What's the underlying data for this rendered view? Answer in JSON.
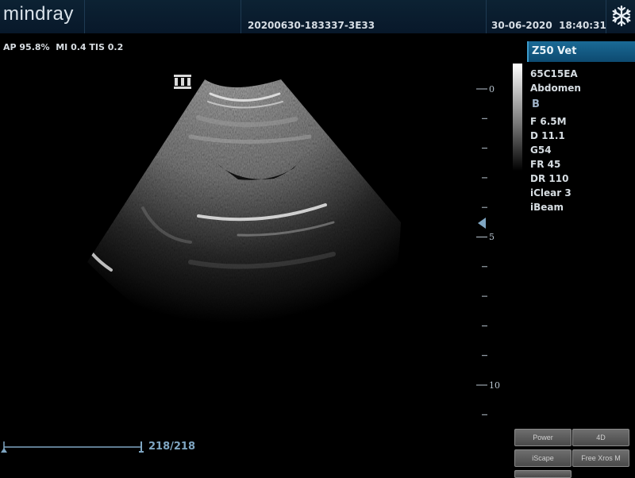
{
  "header": {
    "brand": "mindray",
    "exam_id": "20200630-183337-3E33",
    "datetime": "30-06-2020  18:40:31",
    "freeze_icon": "snowflake-icon"
  },
  "acoustic": {
    "text": "AP 95.8%  MI 0.4 TIS 0.2"
  },
  "probe_marker_icon": "probe-orientation-icon",
  "depth_scale": {
    "labels": [
      "0",
      "5",
      "10"
    ],
    "max_depth_cm": 11.1
  },
  "panel": {
    "preset": "Z50 Vet",
    "probe": "65C15EA",
    "exam": "Abdomen",
    "mode": "B",
    "params": [
      "F 6.5M",
      "D 11.1",
      "G54",
      "FR 45",
      "DR 110",
      "iClear 3",
      "iBeam"
    ]
  },
  "cine": {
    "counter": "218/218",
    "position_fraction": 1.0
  },
  "buttons": {
    "power": "Power",
    "four_d": "4D",
    "iscape": "iScape",
    "free_xros": "Free Xros M"
  },
  "colors": {
    "header_bg": "#0c2233",
    "accent": "#1a6a96",
    "cine": "#7fa6c2"
  }
}
